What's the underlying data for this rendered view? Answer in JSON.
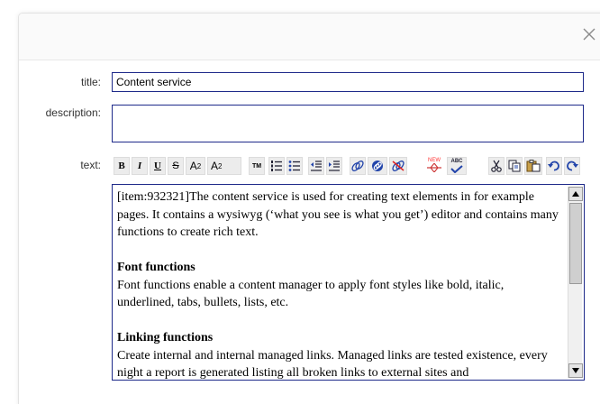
{
  "form": {
    "title_label": "title:",
    "title_value": "Content service",
    "description_label": "description:",
    "description_value": "",
    "text_label": "text:"
  },
  "toolbar": {
    "bold": "B",
    "italic": "I",
    "underline": "U",
    "strike": "S",
    "superscript_base": "A",
    "superscript_mark": "2",
    "subscript_base": "A",
    "subscript_mark": "2",
    "trademark": "TM",
    "new_badge": "NEW",
    "spellcheck": "ABC"
  },
  "editor": {
    "intro": "[item:932321]The content service is used for creating text elements in for example pages. It contains a wysiwyg (‘what you see is what you get’) editor and contains many functions to create rich text.",
    "font_heading": "Font functions",
    "font_body": "Font functions enable a content manager to apply font styles like bold, italic, underlined, tabs, bullets, lists, etc.",
    "link_heading": "Linking functions",
    "link_body": "Create internal and internal managed links. Managed links are tested existence, every night a report is generated listing all broken links to external sites and"
  },
  "colors": {
    "border_accent": "#1e2a8a",
    "new_badge": "#ff3333"
  }
}
